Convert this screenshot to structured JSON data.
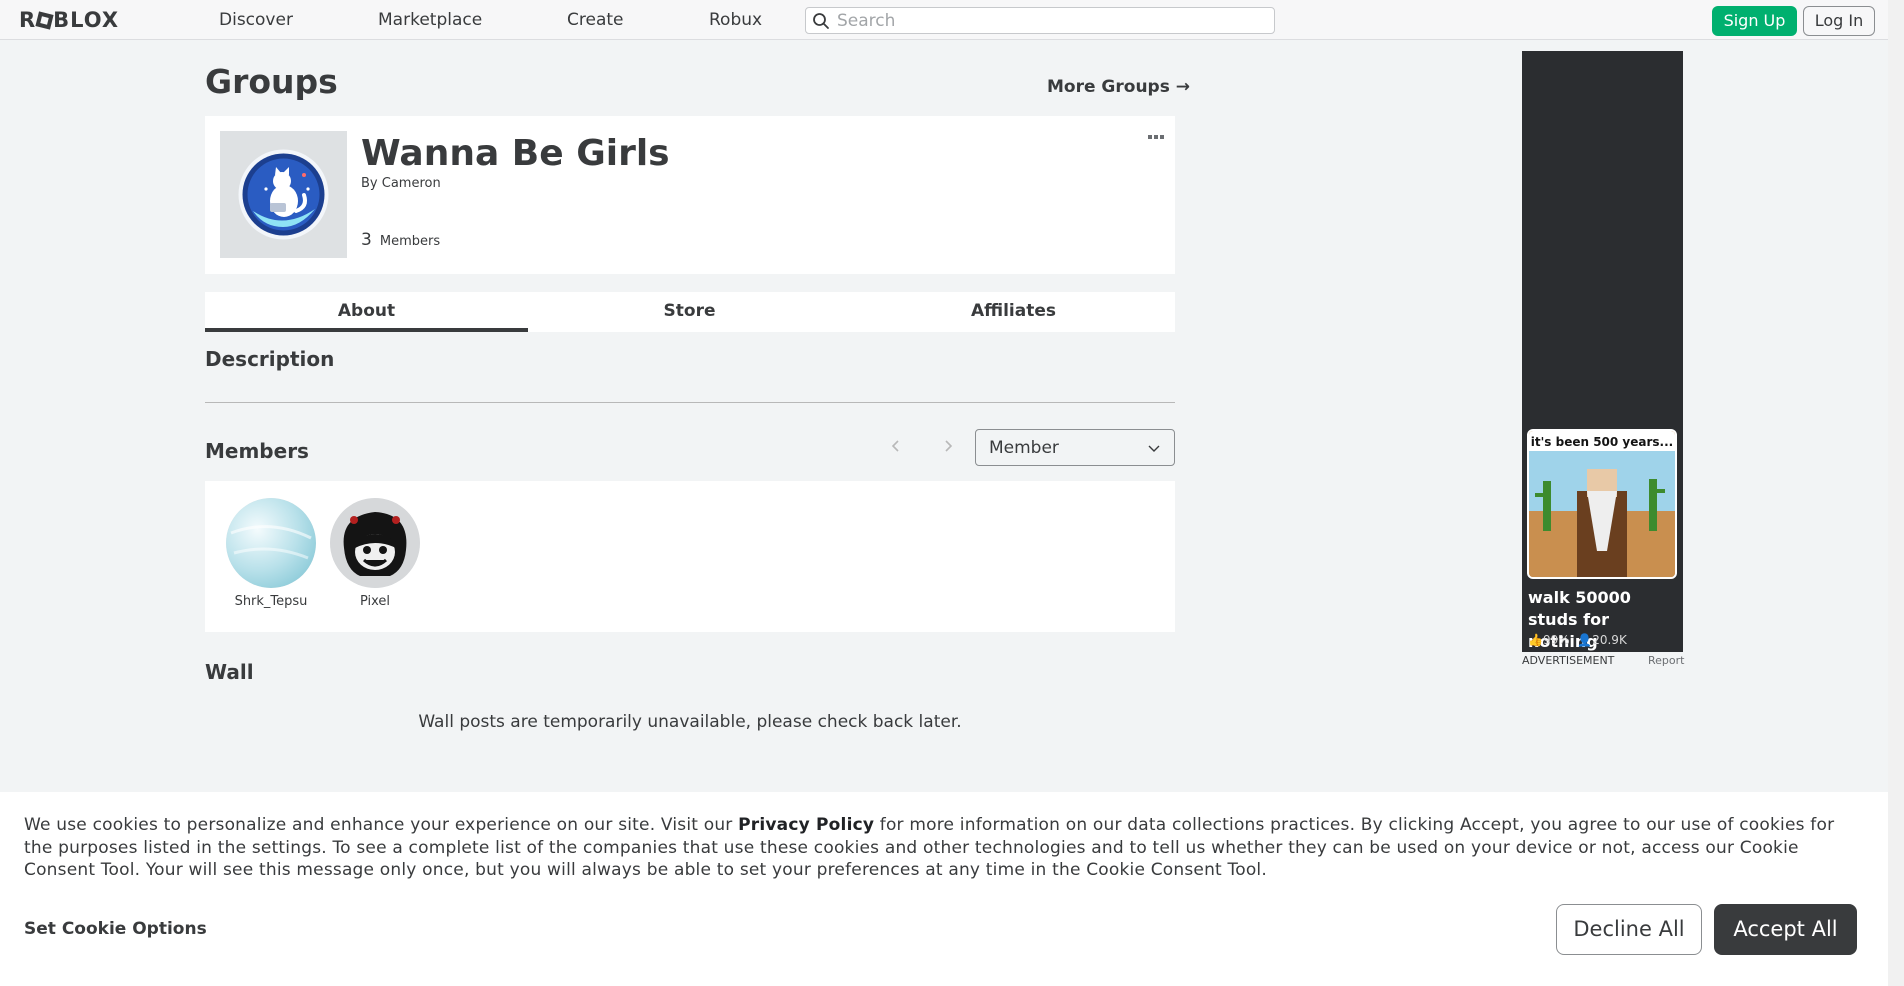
{
  "nav": {
    "logo": "ROBLOX",
    "links": [
      "Discover",
      "Marketplace",
      "Create",
      "Robux"
    ],
    "search_placeholder": "Search",
    "signup": "Sign Up",
    "login": "Log In"
  },
  "page": {
    "title": "Groups",
    "more_groups": "More Groups →"
  },
  "group": {
    "name": "Wanna Be Girls",
    "owner_prefix": "By",
    "owner": "Cameron",
    "member_count": "3",
    "member_label": "Members"
  },
  "tabs": [
    "About",
    "Store",
    "Affiliates"
  ],
  "about": {
    "description_title": "Description",
    "members_title": "Members",
    "role_filter": "Member",
    "members": [
      {
        "name": "Shrk_Tepsu"
      },
      {
        "name": "Pixel"
      }
    ],
    "wall_title": "Wall",
    "wall_message": "Wall posts are temporarily unavailable, please check back later."
  },
  "ad": {
    "image_caption": "it's been 500 years...",
    "title": "walk 50000 studs for nothing",
    "rating": "99%",
    "players": "20.9K",
    "label": "ADVERTISEMENT",
    "report": "Report"
  },
  "cookie": {
    "text_before": "We use cookies to personalize and enhance your experience on our site. Visit our ",
    "privacy_link": "Privacy Policy",
    "text_after": " for more information on our data collections practices. By clicking Accept, you agree to our use of cookies for the purposes listed in the settings. To see a complete list of the companies that use these cookies and other technologies and to tell us whether they can be used on your device or not, access our Cookie Consent Tool. Your will see this message only once, but you will always be able to set your preferences at any time in the Cookie Consent Tool.",
    "options": "Set Cookie Options",
    "decline": "Decline All",
    "accept": "Accept All"
  },
  "colors": {
    "accent_green": "#00b06f",
    "text_dark": "#393b3d",
    "page_bg": "#f2f4f5"
  }
}
